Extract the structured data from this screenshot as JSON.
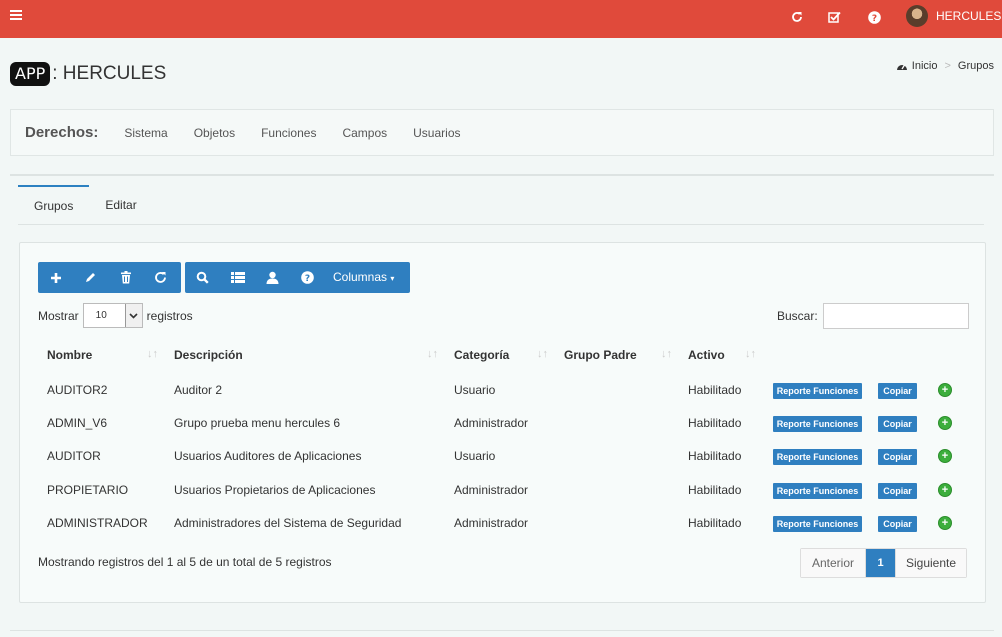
{
  "topbar": {
    "icons": [
      "menu-icon",
      "refresh-icon",
      "check-square-icon",
      "help-icon"
    ],
    "username": "HERCULES"
  },
  "app": {
    "logo": "APP",
    "name": ": HERCULES"
  },
  "breadcrumb": {
    "home": "Inicio",
    "current": "Grupos"
  },
  "rights": {
    "label": "Derechos:",
    "links": [
      "Sistema",
      "Objetos",
      "Funciones",
      "Campos",
      "Usuarios"
    ]
  },
  "tabs": [
    "Grupos",
    "Editar"
  ],
  "toolbar": {
    "icons": [
      "plus-icon",
      "pencil-icon",
      "trash-icon",
      "refresh-icon",
      "search-icon",
      "list-icon",
      "user-icon",
      "help-icon"
    ],
    "columns_label": "Columnas"
  },
  "length": {
    "prefix": "Mostrar",
    "value": "10",
    "suffix": "registros"
  },
  "search": {
    "label": "Buscar:",
    "value": ""
  },
  "table": {
    "headers": [
      "Nombre",
      "Descripción",
      "Categoría",
      "Grupo Padre",
      "Activo"
    ],
    "rows": [
      {
        "nombre": "AUDITOR2",
        "descripcion": "Auditor 2",
        "categoria": "Usuario",
        "padre": "",
        "activo": "Habilitado"
      },
      {
        "nombre": "ADMIN_V6",
        "descripcion": "Grupo prueba menu hercules 6",
        "categoria": "Administrador",
        "padre": "",
        "activo": "Habilitado"
      },
      {
        "nombre": "AUDITOR",
        "descripcion": "Usuarios Auditores de Aplicaciones",
        "categoria": "Usuario",
        "padre": "",
        "activo": "Habilitado"
      },
      {
        "nombre": "PROPIETARIO",
        "descripcion": "Usuarios Propietarios de Aplicaciones",
        "categoria": "Administrador",
        "padre": "",
        "activo": "Habilitado"
      },
      {
        "nombre": "ADMINISTRADOR",
        "descripcion": "Administradores del Sistema de Seguridad",
        "categoria": "Administrador",
        "padre": "",
        "activo": "Habilitado"
      }
    ],
    "report_label": "Reporte Funciones",
    "copy_label": "Copiar"
  },
  "info": "Mostrando registros del 1 al 5 de un total de 5 registros",
  "pager": {
    "prev": "Anterior",
    "current": "1",
    "next": "Siguiente"
  },
  "colors": {
    "topbar": "#e04a3b",
    "primary": "#2f7fc0",
    "add": "#3cae3c"
  }
}
